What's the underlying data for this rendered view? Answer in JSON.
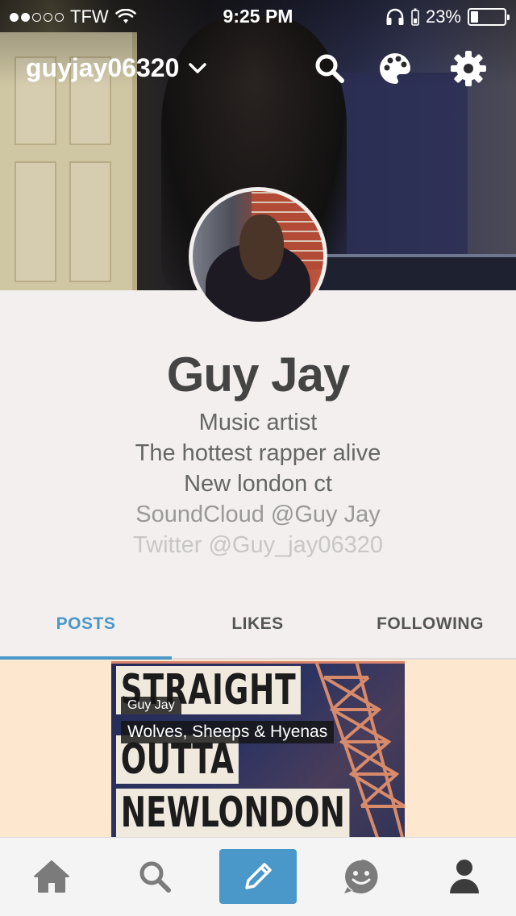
{
  "status_bar": {
    "carrier": "TFW",
    "time": "9:25 PM",
    "battery": "23%",
    "battery_level": 0.23,
    "signal_bars": 2
  },
  "top_nav": {
    "username": "guyjay06320",
    "icons": [
      "search-icon",
      "palette-icon",
      "gear-icon"
    ]
  },
  "profile": {
    "name": "Guy Jay",
    "bio_lines": [
      "Music artist",
      "The hottest rapper alive",
      "New london ct",
      "SoundCloud @Guy Jay",
      "Twitter @Guy_jay06320"
    ]
  },
  "tabs": [
    {
      "label": "POSTS",
      "active": true
    },
    {
      "label": "LIKES",
      "active": false
    },
    {
      "label": "FOLLOWING",
      "active": false
    }
  ],
  "post": {
    "artwork_lines": [
      "STRAIGHT",
      "OUTTA",
      "NEWLONDON"
    ],
    "author": "Guy Jay",
    "title": "Wolves, Sheeps & Hyenas"
  },
  "bottom_bar": {
    "items": [
      "home-icon",
      "search-icon",
      "compose-icon",
      "activity-icon",
      "account-icon"
    ]
  },
  "colors": {
    "accent": "#4a97c9",
    "background": "#f2efee",
    "post_background": "#fde7cf",
    "name_text": "#444444"
  }
}
